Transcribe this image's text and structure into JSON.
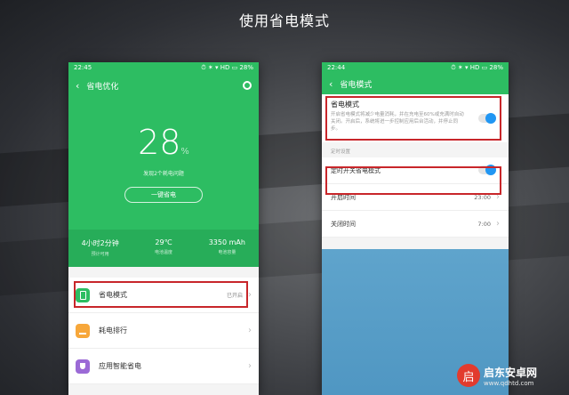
{
  "headline": "使用省电模式",
  "phoneA": {
    "status": {
      "time": "22:45",
      "right": "⏱ ✶ ▾ HD ▭ 28%"
    },
    "appbar": {
      "title": "省电优化"
    },
    "hero": {
      "percent": "28",
      "unit": "%",
      "subtitle": "发现2个耗电问题",
      "button": "一键省电"
    },
    "stats": [
      {
        "value": "4小时2分钟",
        "label": "预计可用"
      },
      {
        "value": "29℃",
        "label": "电池温度"
      },
      {
        "value": "3350 mAh",
        "label": "电池容量"
      }
    ],
    "rows": [
      {
        "label": "省电模式",
        "value": "已开启"
      },
      {
        "label": "耗电排行",
        "value": ""
      },
      {
        "label": "应用智能省电",
        "value": ""
      }
    ]
  },
  "phoneB": {
    "status": {
      "time": "22:44",
      "right": "⏱ ✶ ▾ HD ▭ 28%"
    },
    "appbar": {
      "title": "省电模式"
    },
    "mode": {
      "title": "省电模式",
      "desc": "开启省电模式将减少电量消耗，并在充电至60%或充满时自动关闭。开启后，系统将进一步控制应用后台活动，并停止同步。"
    },
    "group_label": "定时设置",
    "rows": [
      {
        "label": "定时开关省电模式",
        "value": ""
      },
      {
        "label": "开启时间",
        "value": "23:00"
      },
      {
        "label": "关闭时间",
        "value": "7:00"
      }
    ]
  },
  "watermark": {
    "badge": "启",
    "name": "启东安卓网",
    "url": "www.qdhtd.com"
  },
  "colors": {
    "accent": "#2dbd62",
    "highlight": "#c8262a",
    "toggle_on": "#2196f3"
  }
}
